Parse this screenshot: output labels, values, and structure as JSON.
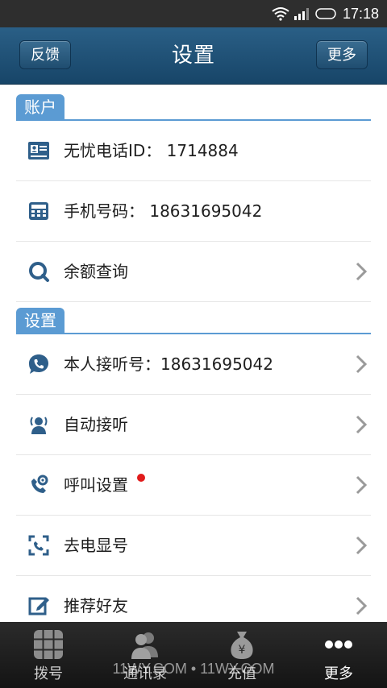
{
  "status_bar": {
    "time": "17:18"
  },
  "header": {
    "title": "设置",
    "left_button": "反馈",
    "right_button": "更多"
  },
  "sections": {
    "account": {
      "title": "账户",
      "items": [
        {
          "icon": "id-card-icon",
          "label": "无忧电话ID： 1714884",
          "has_arrow": false
        },
        {
          "icon": "phone-keypad-icon",
          "label": "手机号码： 18631695042",
          "has_arrow": false
        },
        {
          "icon": "search-icon",
          "label": "余额查询",
          "has_arrow": true
        }
      ]
    },
    "settings": {
      "title": "设置",
      "items": [
        {
          "icon": "chat-phone-icon",
          "label": "本人接听号：18631695042",
          "has_arrow": true
        },
        {
          "icon": "auto-answer-icon",
          "label": "自动接听",
          "has_arrow": true
        },
        {
          "icon": "call-settings-icon",
          "label": "呼叫设置",
          "has_arrow": true,
          "badge": "red-dot"
        },
        {
          "icon": "hide-caller-id-icon",
          "label": "去电显号",
          "has_arrow": true
        },
        {
          "icon": "recommend-edit-icon",
          "label": "推荐好友",
          "has_arrow": true
        }
      ]
    }
  },
  "tabbar": {
    "tabs": [
      {
        "label": "拨号",
        "icon": "dialpad-icon",
        "active": false
      },
      {
        "label": "通讯录",
        "icon": "contacts-icon",
        "active": false
      },
      {
        "label": "充值",
        "icon": "money-bag-icon",
        "active": false
      },
      {
        "label": "更多",
        "icon": "more-dots-icon",
        "active": true
      }
    ]
  },
  "watermark": "11WY.COM • 11WY.COM",
  "colors": {
    "header": "#1f4d70",
    "section_accent": "#5b9bd3",
    "icon_blue": "#2f5f8a",
    "badge_red": "#e11b1b"
  }
}
